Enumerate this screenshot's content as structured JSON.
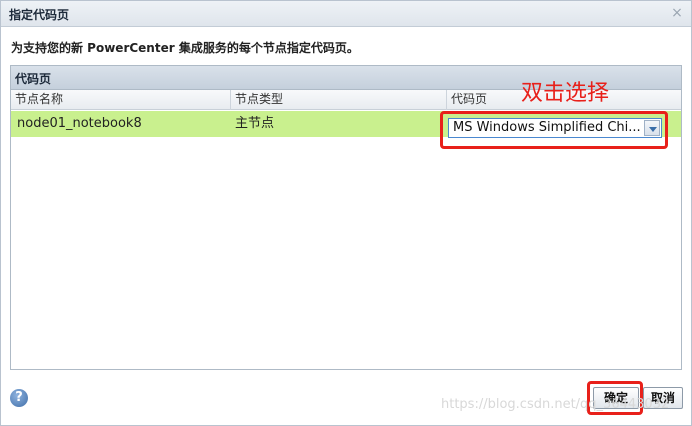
{
  "dialog": {
    "title": "指定代码页",
    "close_symbol": "×",
    "instruction": "为支持您的新 PowerCenter 集成服务的每个节点指定代码页。"
  },
  "panel": {
    "title": "代码页",
    "columns": [
      "节点名称",
      "节点类型",
      "代码页"
    ],
    "rows": [
      {
        "node_name": "node01_notebook8",
        "node_type": "主节点",
        "code_page": "MS Windows Simplified Chi..."
      }
    ]
  },
  "annotation": {
    "text": "双击选择",
    "color": "#e8201a"
  },
  "footer": {
    "help_symbol": "?",
    "ok_label": "确定",
    "cancel_label": "取消"
  },
  "watermark": "https://blog.csdn.net/qq_36443032",
  "colors": {
    "selected_row": "#c9f08e",
    "accent_border": "#4a88d0",
    "highlight": "#e8201a"
  }
}
